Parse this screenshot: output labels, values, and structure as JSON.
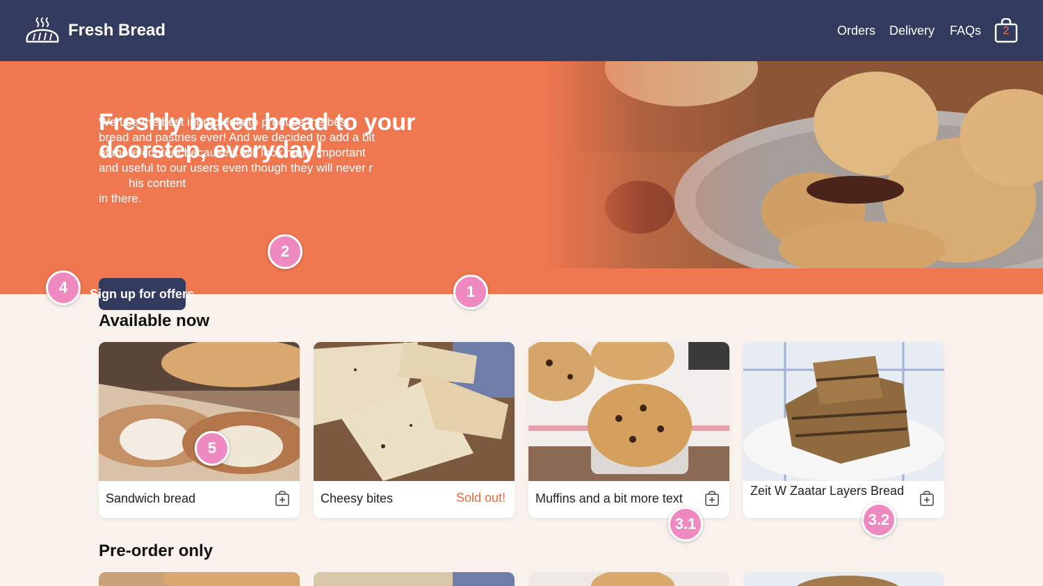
{
  "header": {
    "brand": "Fresh Bread",
    "nav": [
      "Orders",
      "Delivery",
      "FAQs"
    ],
    "cart_count": "2",
    "logo_icon": "bread-steam-icon",
    "cart_icon": "shopping-bag-icon"
  },
  "hero": {
    "title": "Freshly baked bread to your doorstep, everyday!",
    "text": "We use the best ingredients to produce the best bread and pastries ever! And we decided to add a bit of more content because it will look more important and useful to our users even though they will never r",
    "text_tail": "his content",
    "text_last": "in there.",
    "signup_label": "Sign up for offers"
  },
  "sections": {
    "available": "Available now",
    "preorder": "Pre-order only"
  },
  "products": [
    {
      "name": "Sandwich bread",
      "status": "",
      "action_icon": "add-to-cart-icon"
    },
    {
      "name": "Cheesy bites",
      "status": "Sold out!",
      "action_icon": ""
    },
    {
      "name": "Muffins and a bit more text",
      "status": "",
      "action_icon": "add-to-cart-icon"
    },
    {
      "name": "Zeit W Zaatar Layers Bread",
      "status": "",
      "action_icon": "add-to-cart-icon"
    }
  ],
  "badges": [
    "1",
    "2",
    "3.1",
    "3.2",
    "4",
    "5"
  ],
  "colors": {
    "header": "#323a5e",
    "hero": "#f07850",
    "background": "#f8f1ec",
    "sold_out": "#f06a3c",
    "badge": "#ee8ac0"
  }
}
